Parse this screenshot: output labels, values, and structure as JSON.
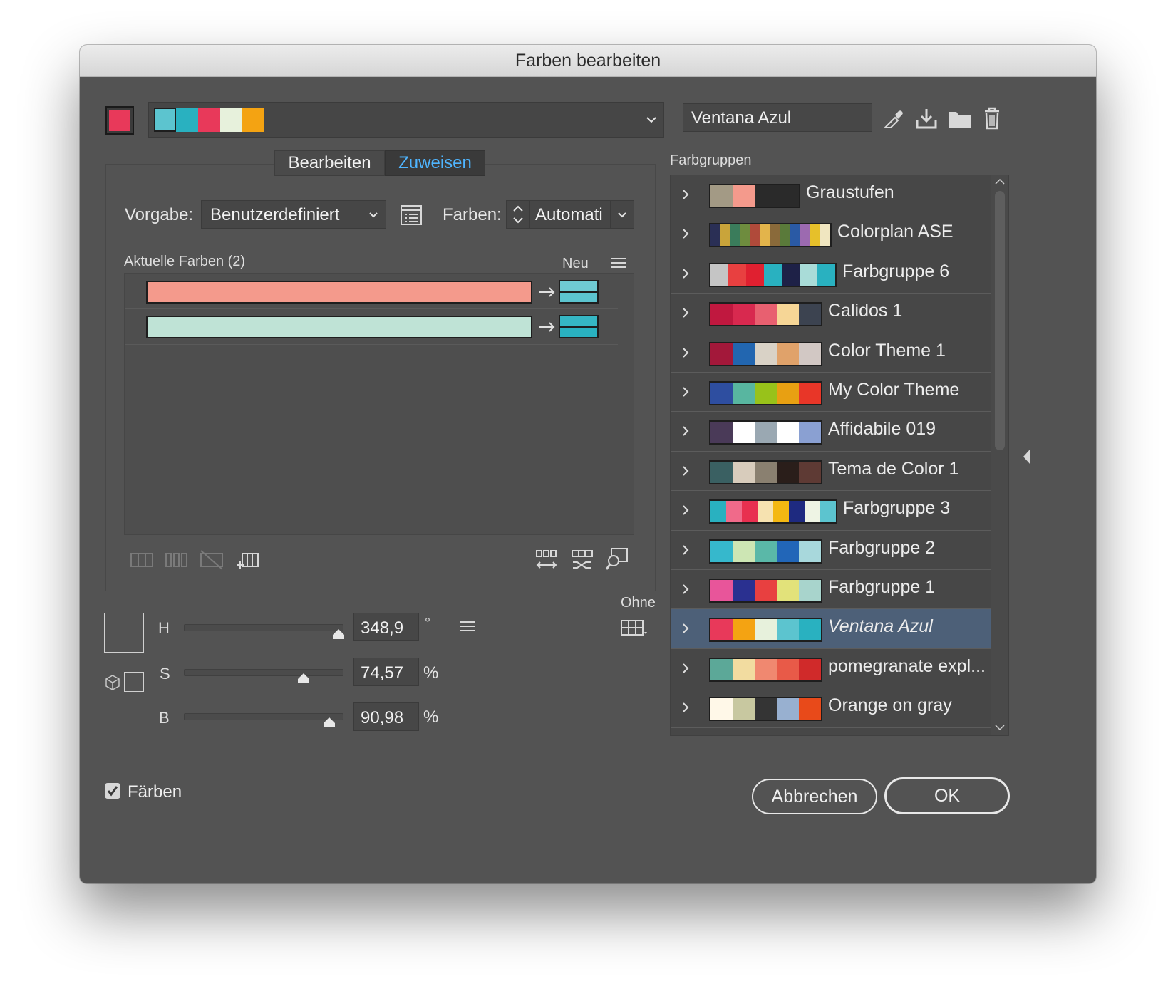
{
  "window": {
    "title": "Farben bearbeiten"
  },
  "top": {
    "active_color": "#e8395a",
    "group_swatches": [
      "#5cc4cf",
      "#29b1c0",
      "#e8395a",
      "#e7f1dc",
      "#f4a312"
    ],
    "group_name_value": "Ventana Azul"
  },
  "tabs": [
    {
      "label": "Bearbeiten",
      "active": false
    },
    {
      "label": "Zuweisen",
      "active": true
    }
  ],
  "assign": {
    "preset_label": "Vorgabe:",
    "preset_value": "Benutzerdefiniert",
    "colors_label": "Farben:",
    "colors_value": "Automati",
    "current_colors_label": "Aktuelle Farben (2)",
    "new_label": "Neu",
    "rows": [
      {
        "current": "#f49a8c",
        "new_top": "#6fcbd3",
        "new_bottom": "#5cc4cf"
      },
      {
        "current": "#bfe3d6",
        "new_top": "#35b6c3",
        "new_bottom": "#29b1c0"
      }
    ]
  },
  "hsb": {
    "h_label": "H",
    "h_value": "348,9",
    "h_unit": "°",
    "h_pos": 0.97,
    "s_label": "S",
    "s_value": "74,57",
    "s_unit": "%",
    "s_pos": 0.75,
    "b_label": "B",
    "b_value": "90,98",
    "b_unit": "%",
    "b_pos": 0.91,
    "none_label": "Ohne"
  },
  "color_groups": {
    "header": "Farbgruppen",
    "items": [
      {
        "name": "Graustufen",
        "swatches": [
          "#a39a85",
          "#f49a8c",
          "#2a2a2a",
          "#2a2a2a"
        ],
        "italic": false,
        "selected": false
      },
      {
        "name": "Colorplan ASE",
        "swatches": [
          "#2a2f55",
          "#c9a43a",
          "#3a7c5b",
          "#6e8c3e",
          "#b04a3a",
          "#e3b44b",
          "#8a6a3a",
          "#5a7a3a",
          "#2a5aa5",
          "#9c6ab0",
          "#e6c02a",
          "#f0e6c0"
        ],
        "italic": false,
        "selected": false
      },
      {
        "name": "Farbgruppe 6",
        "swatches": [
          "#c5c5c5",
          "#e84040",
          "#e02030",
          "#29b1c0",
          "#1e2147",
          "#a9dcd8",
          "#29b1c0"
        ],
        "italic": false,
        "selected": false
      },
      {
        "name": "Calidos 1",
        "swatches": [
          "#c0183f",
          "#d8294f",
          "#e86070",
          "#f6d696",
          "#3c4350"
        ],
        "italic": false,
        "selected": false
      },
      {
        "name": "Color Theme 1",
        "swatches": [
          "#a3183a",
          "#2266b0",
          "#d9d2c6",
          "#e0a26a",
          "#d2c8c4"
        ],
        "italic": false,
        "selected": false
      },
      {
        "name": "My Color Theme",
        "swatches": [
          "#2e4ea0",
          "#58b6a0",
          "#98c21a",
          "#e8a012",
          "#e83628"
        ],
        "italic": false,
        "selected": false
      },
      {
        "name": "Affidabile 019",
        "swatches": [
          "#4a3a58",
          "#ffffff",
          "#9aa8b2",
          "#ffffff",
          "#8aa0d2"
        ],
        "italic": false,
        "selected": false
      },
      {
        "name": "Tema de Color 1",
        "swatches": [
          "#3a6062",
          "#d8ccbc",
          "#8a8070",
          "#2a1e1a",
          "#5e3a34"
        ],
        "italic": false,
        "selected": false
      },
      {
        "name": "Farbgruppe 3",
        "swatches": [
          "#29b1c0",
          "#f06a8a",
          "#e83050",
          "#f6e2b0",
          "#f4b812",
          "#1e2a80",
          "#eef4e4",
          "#5cc4cf"
        ],
        "italic": false,
        "selected": false
      },
      {
        "name": "Farbgruppe 2",
        "swatches": [
          "#36b8cc",
          "#cde6b4",
          "#5ab8a8",
          "#2266b8",
          "#a8d8dc"
        ],
        "italic": false,
        "selected": false
      },
      {
        "name": "Farbgruppe 1",
        "swatches": [
          "#e8559a",
          "#2a3090",
          "#e84040",
          "#e2e27a",
          "#a8d4cc"
        ],
        "italic": false,
        "selected": false
      },
      {
        "name": "Ventana Azul",
        "swatches": [
          "#e8395a",
          "#f4a312",
          "#e7f1dc",
          "#5cc4cf",
          "#29b1c0"
        ],
        "italic": true,
        "selected": true
      },
      {
        "name": "pomegranate expl...",
        "swatches": [
          "#5ca898",
          "#f2dca0",
          "#f08870",
          "#e85a48",
          "#d02a2a"
        ],
        "italic": false,
        "selected": false
      },
      {
        "name": "Orange on gray",
        "swatches": [
          "#fff8e8",
          "#c8c8a0",
          "#343434",
          "#98b0d0",
          "#e84a1a"
        ],
        "italic": false,
        "selected": false
      }
    ]
  },
  "footer": {
    "recolor_label": "Färben",
    "recolor_checked": true,
    "cancel_label": "Abbrechen",
    "ok_label": "OK"
  },
  "icons": [
    "eyedropper-icon",
    "save-icon",
    "folder-icon",
    "trash-icon",
    "table-icon",
    "list-menu-icon"
  ]
}
